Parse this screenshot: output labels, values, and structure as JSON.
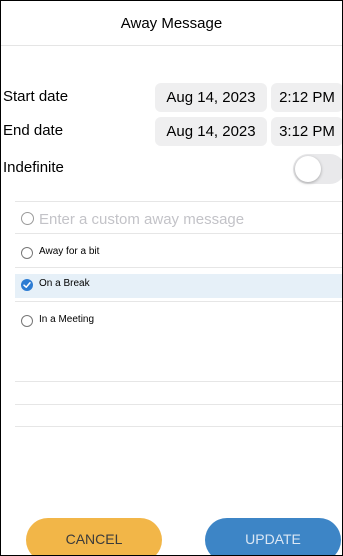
{
  "header": {
    "title": "Away Message"
  },
  "schedule": {
    "start": {
      "label": "Start date",
      "date": "Aug 14, 2023",
      "time": "2:12 PM"
    },
    "end": {
      "label": "End date",
      "date": "Aug 14, 2023",
      "time": "3:12 PM"
    },
    "indefinite": {
      "label": "Indefinite",
      "on": false
    }
  },
  "custom_message": {
    "placeholder": "Enter a custom away message",
    "value": ""
  },
  "options": [
    {
      "label": "Away for a bit",
      "selected": false
    },
    {
      "label": "On a Break",
      "selected": true
    },
    {
      "label": "In a Meeting",
      "selected": false
    }
  ],
  "buttons": {
    "cancel": "CANCEL",
    "update": "UPDATE"
  },
  "colors": {
    "accent": "#3d85c6",
    "cancel": "#f2b648",
    "selected_row": "#e6f0f8"
  }
}
